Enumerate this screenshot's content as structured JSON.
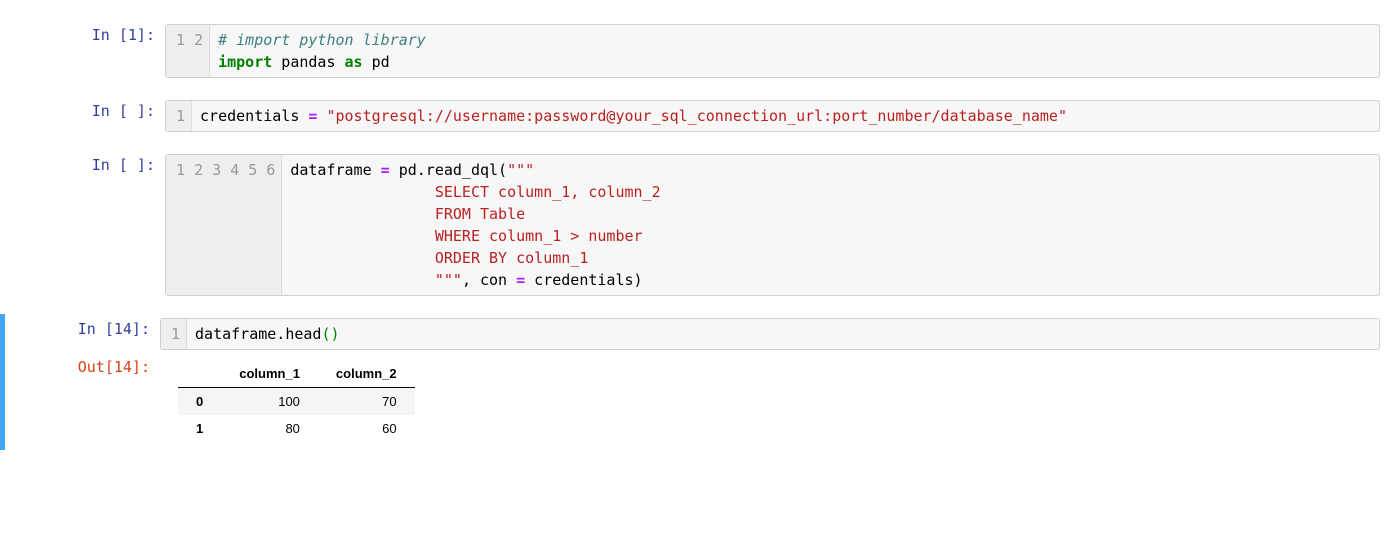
{
  "cells": {
    "c1": {
      "prompt": "In [1]:",
      "gutter": [
        "1",
        "2"
      ],
      "tokens": {
        "comment": "# import python library",
        "import_kw": "import",
        "pandas": " pandas ",
        "as_kw": "as",
        "pd": " pd"
      }
    },
    "c2": {
      "prompt": "In [ ]:",
      "gutter": [
        "1"
      ],
      "tokens": {
        "credentials": "credentials ",
        "eq": "=",
        "sp": " ",
        "str": "\"postgresql://username:password@your_sql_connection_url:port_number/database_name\""
      }
    },
    "c3": {
      "prompt": "In [ ]:",
      "gutter": [
        "1",
        "2",
        "3",
        "4",
        "5",
        "6"
      ],
      "tokens": {
        "l1a": "dataframe ",
        "eq": "=",
        "l1b": " pd.read_dql(",
        "l1s": "\"\"\"",
        "l2": "                SELECT column_1, column_2",
        "l3": "                FROM Table",
        "l4": "                WHERE column_1 > number",
        "l5": "                ORDER BY column_1",
        "l6s": "                \"\"\"",
        "l6a": ", con ",
        "l6eq": "=",
        "l6b": " credentials)"
      }
    },
    "c4": {
      "prompt": "In [14]:",
      "out_prompt": "Out[14]:",
      "gutter": [
        "1"
      ],
      "tokens": {
        "a": "dataframe.head",
        "p1": "(",
        "p2": ")"
      },
      "table": {
        "columns": [
          "",
          "column_1",
          "column_2"
        ],
        "rows": [
          {
            "idx": "0",
            "c1": "100",
            "c2": "70"
          },
          {
            "idx": "1",
            "c1": "80",
            "c2": "60"
          }
        ]
      }
    }
  }
}
